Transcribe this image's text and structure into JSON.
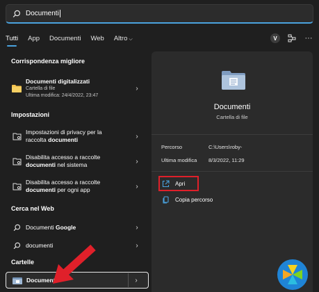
{
  "search": {
    "value": "Documenti"
  },
  "tabs": [
    {
      "label": "Tutti"
    },
    {
      "label": "App"
    },
    {
      "label": "Documenti"
    },
    {
      "label": "Web"
    },
    {
      "label": "Altro"
    }
  ],
  "account": {
    "initial": "V"
  },
  "left": {
    "best_match_title": "Corrispondenza migliore",
    "best_match": {
      "name": "Documenti digitalizzati",
      "type": "Cartella di file",
      "modified": "Ultima modifica: 24/4/2022, 23:47"
    },
    "settings_title": "Impostazioni",
    "settings": [
      {
        "line1": "Impostazioni di privacy per la",
        "line2_pre": "raccolta ",
        "line2_bold": "documenti",
        "line2_post": ""
      },
      {
        "line1": "Disabilita accesso a raccolte",
        "line2_pre": "",
        "line2_bold": "documenti",
        "line2_post": " nel sistema"
      },
      {
        "line1": "Disabilita accesso a raccolte",
        "line2_pre": "",
        "line2_bold": "documenti",
        "line2_post": " per ogni app"
      }
    ],
    "web_title": "Cerca nel Web",
    "web": [
      {
        "pre": "Documenti ",
        "bold": "Google"
      },
      {
        "pre": "documenti",
        "bold": ""
      }
    ],
    "folders_title": "Cartelle",
    "folder": {
      "name": "Documenti"
    }
  },
  "right": {
    "title": "Documenti",
    "subtitle": "Cartella di file",
    "path_label": "Percorso",
    "path_value": "C:\\Users\\roby-",
    "modified_label": "Ultima modifica",
    "modified_value": "8/3/2022, 11:29",
    "open_label": "Apri",
    "copy_path_label": "Copia percorso"
  },
  "colors": {
    "accent": "#4aa3df",
    "highlight_border": "#e0202a",
    "folder": "#f2c14e"
  }
}
